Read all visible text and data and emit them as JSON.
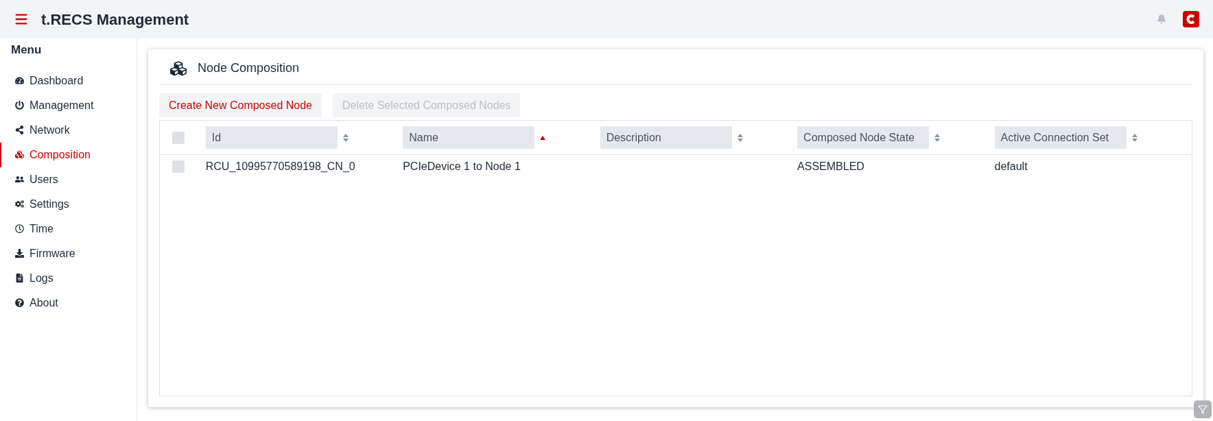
{
  "header": {
    "title": "t.RECS Management"
  },
  "sidebar": {
    "title": "Menu",
    "items": [
      {
        "label": "Dashboard",
        "selected": false
      },
      {
        "label": "Management",
        "selected": false
      },
      {
        "label": "Network",
        "selected": false
      },
      {
        "label": "Composition",
        "selected": true
      },
      {
        "label": "Users",
        "selected": false
      },
      {
        "label": "Settings",
        "selected": false
      },
      {
        "label": "Time",
        "selected": false
      },
      {
        "label": "Firmware",
        "selected": false
      },
      {
        "label": "Logs",
        "selected": false
      },
      {
        "label": "About",
        "selected": false
      }
    ]
  },
  "card": {
    "title": "Node Composition",
    "buttons": [
      {
        "label": "Create New Composed Node",
        "disabled": false
      },
      {
        "label": "Delete Selected Composed Nodes",
        "disabled": true
      }
    ],
    "table": {
      "select_all": {
        "checked": false
      },
      "columns": [
        {
          "label": "Id",
          "sorted": false
        },
        {
          "label": "Name",
          "sorted": true
        },
        {
          "label": "Description",
          "sorted": false
        },
        {
          "label": "Composed Node State",
          "sorted": false
        },
        {
          "label": "Active Connection Set",
          "sorted": false
        }
      ],
      "rows": [
        {
          "checked": false,
          "cells": [
            "RCU_10995770589198_CN_0",
            "PCIeDevice 1 to Node 1",
            "",
            "ASSEMBLED",
            "default"
          ]
        }
      ]
    }
  }
}
